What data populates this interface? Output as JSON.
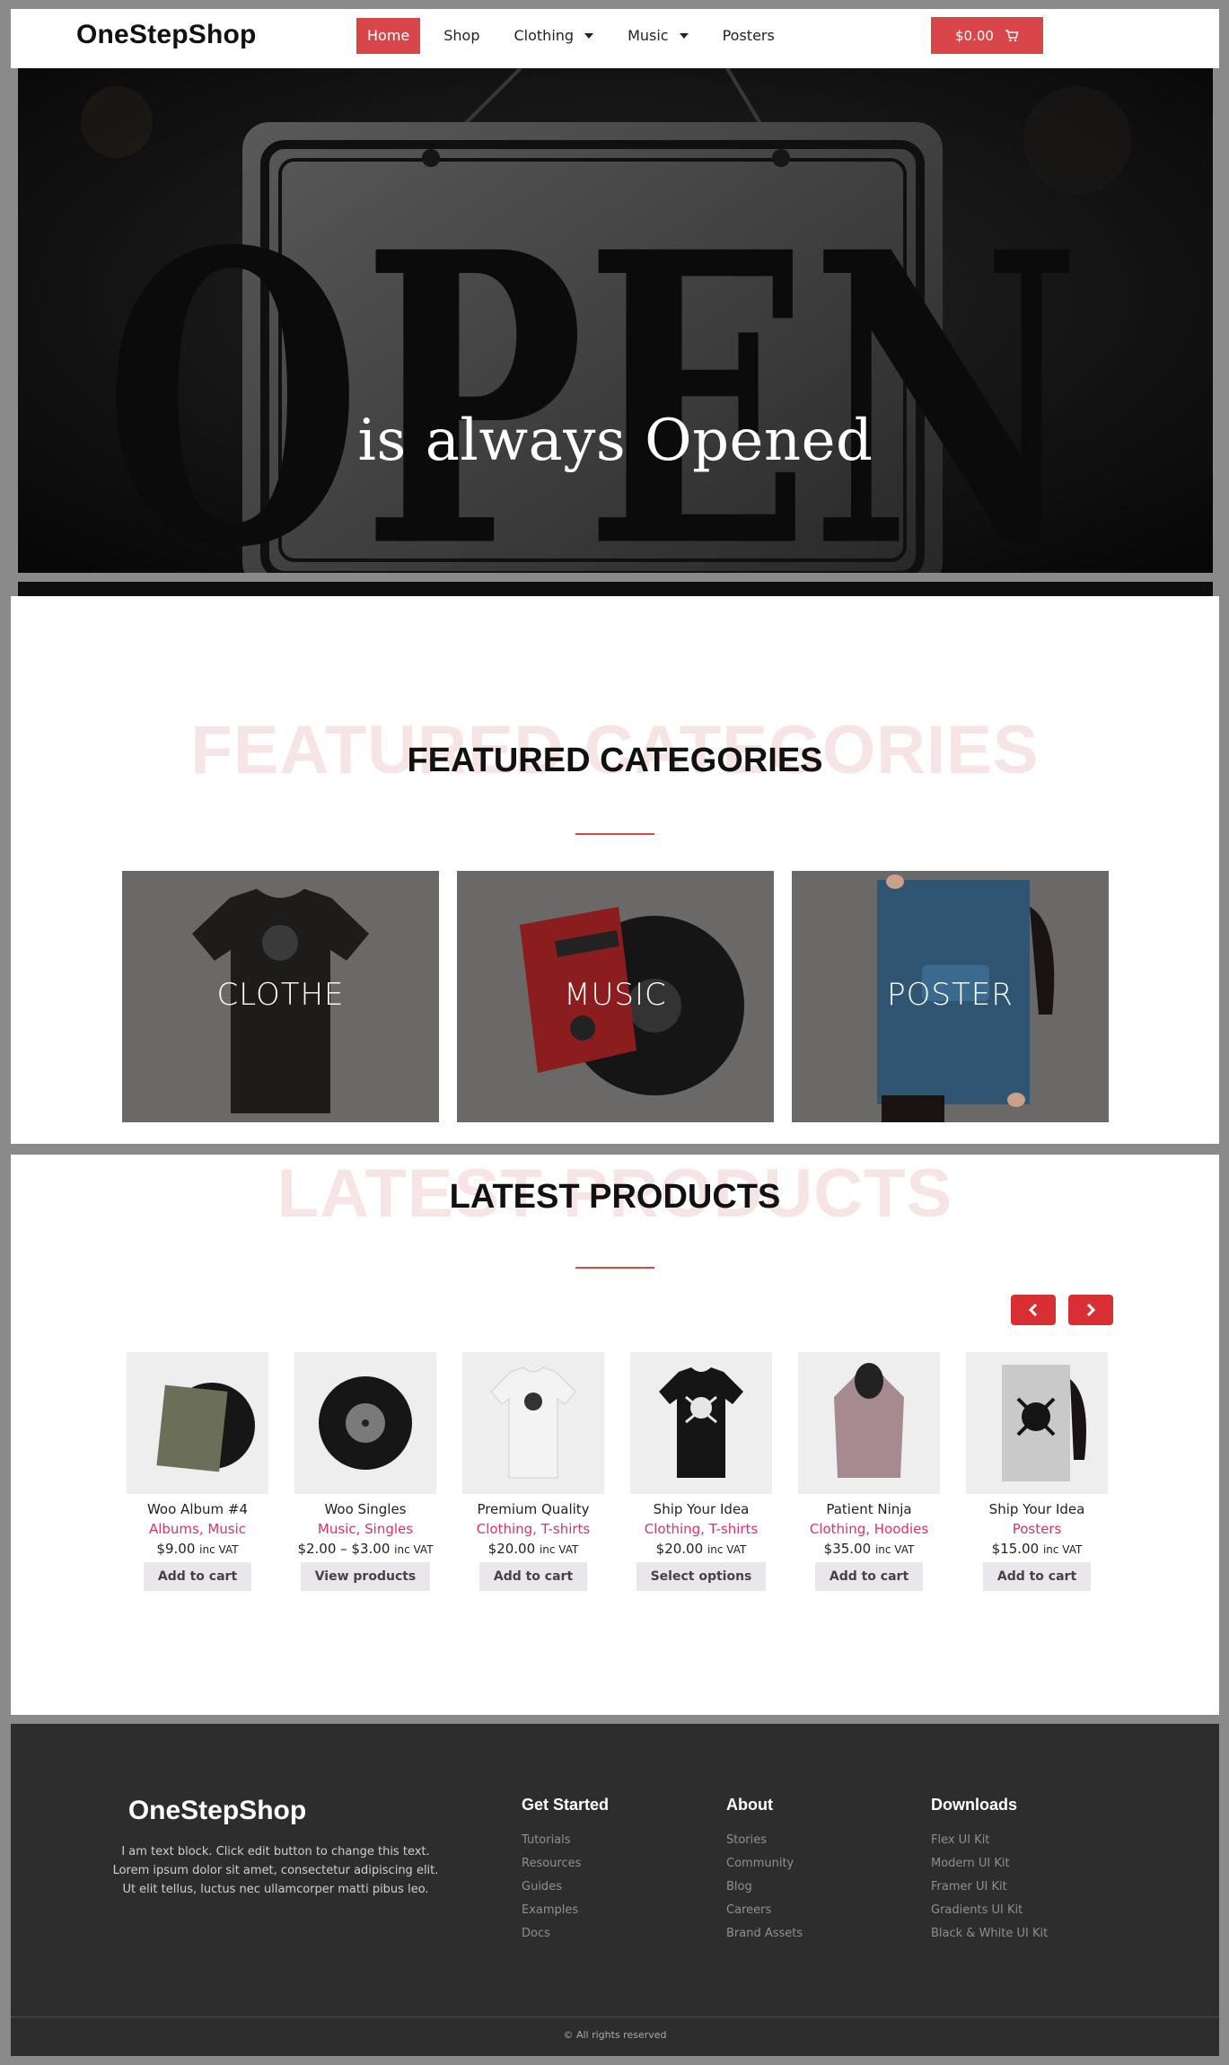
{
  "header": {
    "logo": "OneStepShop",
    "nav": [
      {
        "label": "Home",
        "active": true
      },
      {
        "label": "Shop"
      },
      {
        "label": "Clothing",
        "dropdown": true
      },
      {
        "label": "Music",
        "dropdown": true
      },
      {
        "label": "Posters"
      }
    ],
    "cart_total": "$0.00",
    "accent": "#d84649"
  },
  "hero": {
    "title": "is always Opened",
    "sign_text": "OPEN"
  },
  "featured": {
    "ghost_title": "FEATURED CATEGORIES",
    "title": "FEATURED CATEGORIES",
    "categories": [
      {
        "label": "CLOTHE"
      },
      {
        "label": "MUSIC"
      },
      {
        "label": "POSTER"
      }
    ]
  },
  "latest": {
    "ghost_title": "LATEST PRODUCTS",
    "title": "LATEST PRODUCTS",
    "prev_icon": "chevron-left-icon",
    "next_icon": "chevron-right-icon",
    "products": [
      {
        "name": "Woo Album #4",
        "categories": "Albums, Music",
        "price": "$9.00",
        "tax": "inc VAT",
        "button": "Add to cart"
      },
      {
        "name": "Woo Singles",
        "categories": "Music, Singles",
        "price": "$2.00 – $3.00",
        "tax": "inc VAT",
        "button": "View products"
      },
      {
        "name": "Premium Quality",
        "categories": "Clothing, T-shirts",
        "price": "$20.00",
        "tax": "inc VAT",
        "button": "Add to cart"
      },
      {
        "name": "Ship Your Idea",
        "categories": "Clothing, T-shirts",
        "price": "$20.00",
        "tax": "inc VAT",
        "button": "Select options"
      },
      {
        "name": "Patient Ninja",
        "categories": "Clothing, Hoodies",
        "price": "$35.00",
        "tax": "inc VAT",
        "button": "Add to cart"
      },
      {
        "name": "Ship Your Idea",
        "categories": "Posters",
        "price": "$15.00",
        "tax": "inc VAT",
        "button": "Add to cart"
      }
    ]
  },
  "footer": {
    "logo": "OneStepShop",
    "text": "I am text block. Click edit button to change this text. Lorem ipsum dolor sit amet, consectetur adipiscing elit. Ut elit tellus, luctus nec ullamcorper matti pibus leo.",
    "columns": [
      {
        "title": "Get Started",
        "links": [
          "Tutorials",
          "Resources",
          "Guides",
          "Examples",
          "Docs"
        ]
      },
      {
        "title": "About",
        "links": [
          "Stories",
          "Community",
          "Blog",
          "Careers",
          "Brand Assets"
        ]
      },
      {
        "title": "Downloads",
        "links": [
          "Flex UI Kit",
          "Modern UI Kit",
          "Framer UI Kit",
          "Gradients UI Kit",
          "Black & White UI Kit"
        ]
      }
    ],
    "copyright": "© All rights reserved"
  }
}
